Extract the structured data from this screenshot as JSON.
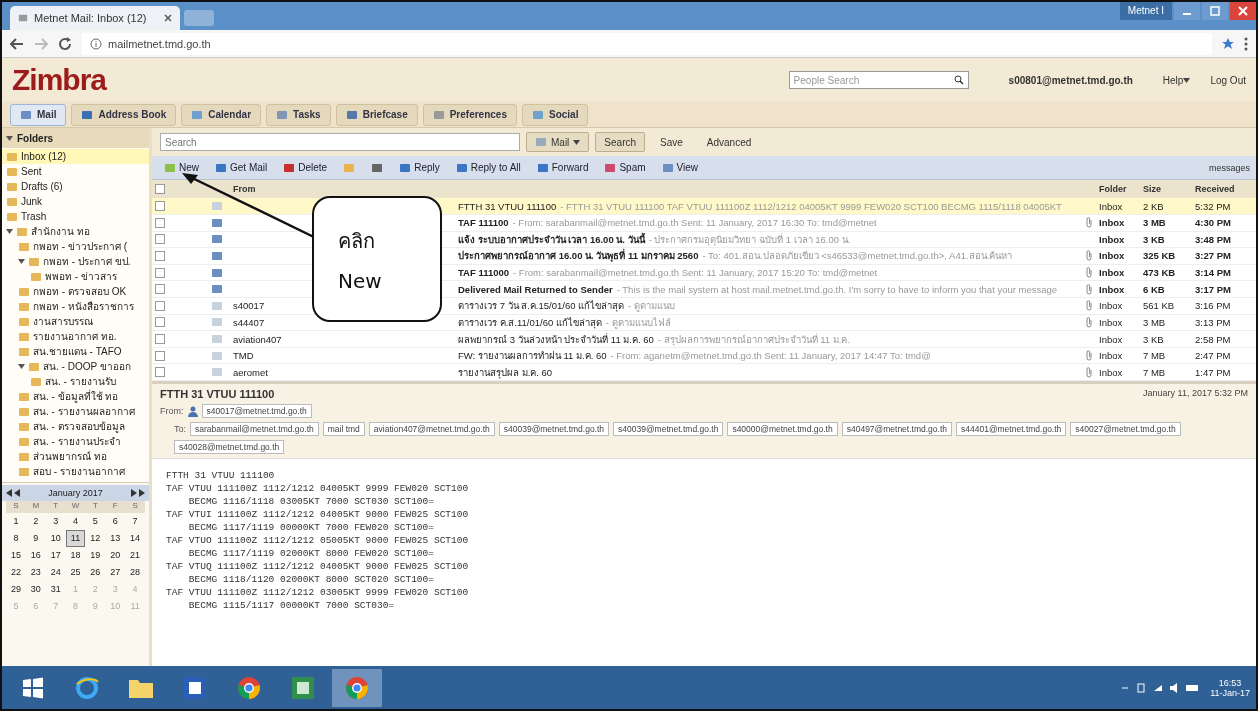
{
  "browser": {
    "tab_title": "Metnet Mail: Inbox (12)",
    "profile": "Metnet I",
    "url": "mailmetnet.tmd.go.th"
  },
  "header": {
    "logo": "Zimbra",
    "people_search_placeholder": "People Search",
    "user": "s00801@metnet.tmd.go.th",
    "help": "Help",
    "logout": "Log Out"
  },
  "app_tabs": [
    {
      "label": "Mail",
      "selected": true
    },
    {
      "label": "Address Book",
      "selected": false
    },
    {
      "label": "Calendar",
      "selected": false
    },
    {
      "label": "Tasks",
      "selected": false
    },
    {
      "label": "Briefcase",
      "selected": false
    },
    {
      "label": "Preferences",
      "selected": false
    },
    {
      "label": "Social",
      "selected": false
    }
  ],
  "sidebar": {
    "heading": "Folders",
    "folders": [
      {
        "name": "Inbox (12)",
        "selected": true
      },
      {
        "name": "Sent",
        "selected": false
      },
      {
        "name": "Drafts (6)",
        "selected": false
      },
      {
        "name": "Junk",
        "selected": false
      },
      {
        "name": "Trash",
        "selected": false
      },
      {
        "name": "สำนักงาน ทอ",
        "selected": false,
        "expanded": true,
        "children": [
          {
            "name": "กพอท - ข่าวประกาศ (",
            "selected": false
          },
          {
            "name": "กพอท - ประกาศ ขป.",
            "selected": false,
            "expanded": true,
            "children": [
              {
                "name": "พพอท - ข่าวสาร",
                "selected": false
              }
            ]
          },
          {
            "name": "กพอท - ตรวจสอบ OK",
            "selected": false
          },
          {
            "name": "กพอท - หนังสือราชการ",
            "selected": false
          },
          {
            "name": "งานสารบรรณ",
            "selected": false
          },
          {
            "name": "รายงานอากาศ ทอ.",
            "selected": false
          },
          {
            "name": "สน.ชายแดน - TAFO",
            "selected": false
          },
          {
            "name": "สน. - DOOP ขาออก",
            "selected": false,
            "expanded": true,
            "children": [
              {
                "name": "สน. - รายงานรับ",
                "selected": false
              }
            ]
          },
          {
            "name": "สน. - ข้อมูลที่ใช้ ทอ",
            "selected": false
          },
          {
            "name": "สน. - รายงานผลอากาศ",
            "selected": false
          },
          {
            "name": "สน. - ตรวจสอบข้อมูล",
            "selected": false
          },
          {
            "name": "สน. - รายงานประจำ",
            "selected": false
          },
          {
            "name": "ส่วนพยากรณ์ ทอ",
            "selected": false
          },
          {
            "name": "สอบ - รายงานอากาศ",
            "selected": false
          }
        ]
      }
    ]
  },
  "calendar": {
    "month": "January 2017",
    "weekdays": [
      "S",
      "M",
      "T",
      "W",
      "T",
      "F",
      "S"
    ],
    "weeks": [
      [
        {
          "day": "1",
          "current": true,
          "selected": false
        },
        {
          "day": "2",
          "current": true,
          "selected": false
        },
        {
          "day": "3",
          "current": true,
          "selected": false
        },
        {
          "day": "4",
          "current": true,
          "selected": false
        },
        {
          "day": "5",
          "current": true,
          "selected": false
        },
        {
          "day": "6",
          "current": true,
          "selected": false
        },
        {
          "day": "7",
          "current": true,
          "selected": false
        }
      ],
      [
        {
          "day": "8",
          "current": true,
          "selected": false
        },
        {
          "day": "9",
          "current": true,
          "selected": false
        },
        {
          "day": "10",
          "current": true,
          "selected": false
        },
        {
          "day": "11",
          "current": true,
          "selected": true
        },
        {
          "day": "12",
          "current": true,
          "selected": false
        },
        {
          "day": "13",
          "current": true,
          "selected": false
        },
        {
          "day": "14",
          "current": true,
          "selected": false
        }
      ],
      [
        {
          "day": "15",
          "current": true,
          "selected": false
        },
        {
          "day": "16",
          "current": true,
          "selected": false
        },
        {
          "day": "17",
          "current": true,
          "selected": false
        },
        {
          "day": "18",
          "current": true,
          "selected": false
        },
        {
          "day": "19",
          "current": true,
          "selected": false
        },
        {
          "day": "20",
          "current": true,
          "selected": false
        },
        {
          "day": "21",
          "current": true,
          "selected": false
        }
      ],
      [
        {
          "day": "22",
          "current": true,
          "selected": false
        },
        {
          "day": "23",
          "current": true,
          "selected": false
        },
        {
          "day": "24",
          "current": true,
          "selected": false
        },
        {
          "day": "25",
          "current": true,
          "selected": false
        },
        {
          "day": "26",
          "current": true,
          "selected": false
        },
        {
          "day": "27",
          "current": true,
          "selected": false
        },
        {
          "day": "28",
          "current": true,
          "selected": false
        }
      ],
      [
        {
          "day": "29",
          "current": true,
          "selected": false
        },
        {
          "day": "30",
          "current": true,
          "selected": false
        },
        {
          "day": "31",
          "current": true,
          "selected": false
        },
        {
          "day": "1",
          "current": false,
          "selected": false
        },
        {
          "day": "2",
          "current": false,
          "selected": false
        },
        {
          "day": "3",
          "current": false,
          "selected": false
        },
        {
          "day": "4",
          "current": false,
          "selected": false
        }
      ],
      [
        {
          "day": "5",
          "current": false,
          "selected": false
        },
        {
          "day": "6",
          "current": false,
          "selected": false
        },
        {
          "day": "7",
          "current": false,
          "selected": false
        },
        {
          "day": "8",
          "current": false,
          "selected": false
        },
        {
          "day": "9",
          "current": false,
          "selected": false
        },
        {
          "day": "10",
          "current": false,
          "selected": false
        },
        {
          "day": "11",
          "current": false,
          "selected": false
        }
      ]
    ]
  },
  "search": {
    "placeholder": "Search",
    "scope": "Mail",
    "buttons": [
      "Search",
      "Save",
      "Advanced"
    ]
  },
  "toolbar": [
    {
      "kind": "labeled",
      "label": "New"
    },
    {
      "kind": "labeled",
      "label": "Get Mail"
    },
    {
      "kind": "labeled",
      "label": "Delete"
    },
    {
      "kind": "icon"
    },
    {
      "kind": "icon"
    },
    {
      "kind": "labeled",
      "label": "Reply"
    },
    {
      "kind": "labeled",
      "label": "Reply to All"
    },
    {
      "kind": "labeled",
      "label": "Forward"
    },
    {
      "kind": "labeled",
      "label": "Spam"
    },
    {
      "kind": "labeled",
      "label": "View"
    }
  ],
  "select_all": {
    "checked": false
  },
  "toolbar_right": "messages",
  "columns": {
    "from": "From",
    "folder": "Folder",
    "size": "Size",
    "received": "Received"
  },
  "messages": [
    {
      "subject": "FTTH 31 VTUU 111100",
      "fragment": "- FTTH 31 VTUU 111100 TAF VTUU 111100Z 1112/1212 04005KT 9999 FEW020 SCT100 BECMG 1115/1118 04005KT",
      "folder": "Inbox",
      "size": "2 KB",
      "received": "5:32 PM",
      "unread": false,
      "selected": true,
      "attachment": false
    },
    {
      "subject": "TAF 111100",
      "fragment": "- From: sarabanmail@metnet.tmd.go.th Sent: 11 January, 2017 16:30 To: tmd@metnet",
      "folder": "Inbox",
      "size": "3 MB",
      "received": "4:30 PM",
      "unread": true,
      "selected": false,
      "attachment": true
    },
    {
      "subject": "แจ้ง ระบบอากาศประจำวัน เวลา 16.00 น. วันนี้",
      "fragment": "- ประกาศกรมอุตุนิยมวิทยา ฉบับที่ 1 เวลา 16.00 น.",
      "folder": "Inbox",
      "size": "3 KB",
      "received": "3:48 PM",
      "unread": true,
      "selected": false,
      "attachment": false
    },
    {
      "subject": "ประกาศพยากรณ์อากาศ 16.00 น. วันพุธที่ 11 มกราคม 2560",
      "fragment": "- To: 401.สอน.ปลอดภัยเขียว <s46533@metnet.tmd.go.th>, A41.สอน.ค้นหา",
      "folder": "Inbox",
      "size": "325 KB",
      "received": "3:27 PM",
      "unread": true,
      "selected": false,
      "attachment": true
    },
    {
      "subject": "TAF 111000",
      "fragment": "- From: sarabanmail@metnet.tmd.go.th Sent: 11 January, 2017 15:20 To: tmd@metnet",
      "folder": "Inbox",
      "size": "473 KB",
      "received": "3:14 PM",
      "unread": true,
      "selected": false,
      "attachment": true
    },
    {
      "subject": "Delivered Mail Returned to Sender",
      "fragment": "- This is the mail system at host mail.metnet.tmd.go.th. I'm sorry to have to inform you that your message",
      "folder": "Inbox",
      "size": "6 KB",
      "received": "3:17 PM",
      "unread": true,
      "selected": false,
      "attachment": true
    },
    {
      "from": "s40017",
      "subject": "ตารางเวร 7 วัน ส.ค.15/01/60 แก้ไขล่าสุด",
      "fragment": "- ดูตามแนบ",
      "folder": "Inbox",
      "size": "561 KB",
      "received": "3:16 PM",
      "unread": false,
      "selected": false,
      "attachment": true
    },
    {
      "from": "s44407",
      "subject": "ตารางเวร ค.ส.11/01/60 แก้ไขล่าสุด",
      "fragment": "- ดูตามแนบไฟล์",
      "folder": "Inbox",
      "size": "3 MB",
      "received": "3:13 PM",
      "unread": false,
      "selected": false,
      "attachment": true
    },
    {
      "from": "aviation407",
      "subject": "ผลพยากรณ์ 3 วันล่วงหน้า ประจำวันที่ 11 ม.ค. 60",
      "fragment": "- สรุปผลการพยากรณ์อากาศประจำวันที่ 11 ม.ค.",
      "folder": "Inbox",
      "size": "3 KB",
      "received": "2:58 PM",
      "unread": false,
      "selected": false,
      "attachment": false
    },
    {
      "from": "TMD",
      "subject": "FW: รายงานผลการทำฝน 11 ม.ค. 60",
      "fragment": "- From: aganetm@metnet.tmd.go.th Sent: 11 January, 2017 14:47 To: tmd@",
      "folder": "Inbox",
      "size": "7 MB",
      "received": "2:47 PM",
      "unread": false,
      "selected": false,
      "attachment": true
    },
    {
      "from": "aeromet",
      "subject": "รายงานสรุปผล ม.ค. 60",
      "folder": "Inbox",
      "size": "7 MB",
      "received": "1:47 PM",
      "unread": false,
      "selected": false,
      "attachment": true
    }
  ],
  "reading": {
    "subject": "FTTH 31 VTUU 111100",
    "date": "January 11, 2017 5:32 PM",
    "from_label": "From:",
    "from": "s40017@metnet.tmd.go.th",
    "to_label": "To:",
    "to": [
      "sarabanmail@metnet.tmd.go.th",
      "mail tmd",
      "aviation407@metnet.tmd.go.th",
      "s40039@metnet.tmd.go.th",
      "s40039@metnet.tmd.go.th",
      "s40000@metnet.tmd.go.th",
      "s40497@metnet.tmd.go.th",
      "s44401@metnet.tmd.go.th",
      "s40027@metnet.tmd.go.th",
      "s40028@metnet.tmd.go.th"
    ]
  },
  "body": [
    "FTTH 31 VTUU 111100",
    "TAF VTUU 111100Z 1112/1212 04005KT 9999 FEW020 SCT100",
    "    BECMG 1116/1118 03005KT 7000 SCT030 SCT100=",
    "TAF VTUI 111100Z 1112/1212 04005KT 9000 FEW025 SCT100",
    "    BECMG 1117/1119 00000KT 7000 FEW020 SCT100=",
    "TAF VTUO 111100Z 1112/1212 05005KT 9000 FEW025 SCT100",
    "    BECMG 1117/1119 02000KT 8000 FEW020 SCT100=",
    "TAF VTUQ 111100Z 1112/1212 04005KT 9000 FEW025 SCT100",
    "    BECMG 1118/1120 02000KT 8000 SCT020 SCT100=",
    "TAF VTUU 111100Z 1112/1212 03005KT 9999 FEW020 SCT100",
    "    BECMG 1115/1117 00000KT 7000 SCT030="
  ],
  "callout": {
    "lines": [
      "คลิก",
      "New"
    ]
  },
  "taskbar": {
    "apps": [
      {
        "kind": "windows",
        "selected": false
      },
      {
        "kind": "ie",
        "selected": false
      },
      {
        "kind": "explorer",
        "selected": false
      },
      {
        "kind": "word",
        "selected": false
      },
      {
        "kind": "chrome",
        "selected": false
      },
      {
        "kind": "excel",
        "selected": false
      },
      {
        "kind": "chrome",
        "selected": true
      }
    ],
    "time": "16:53",
    "date": "11-Jan-17"
  }
}
